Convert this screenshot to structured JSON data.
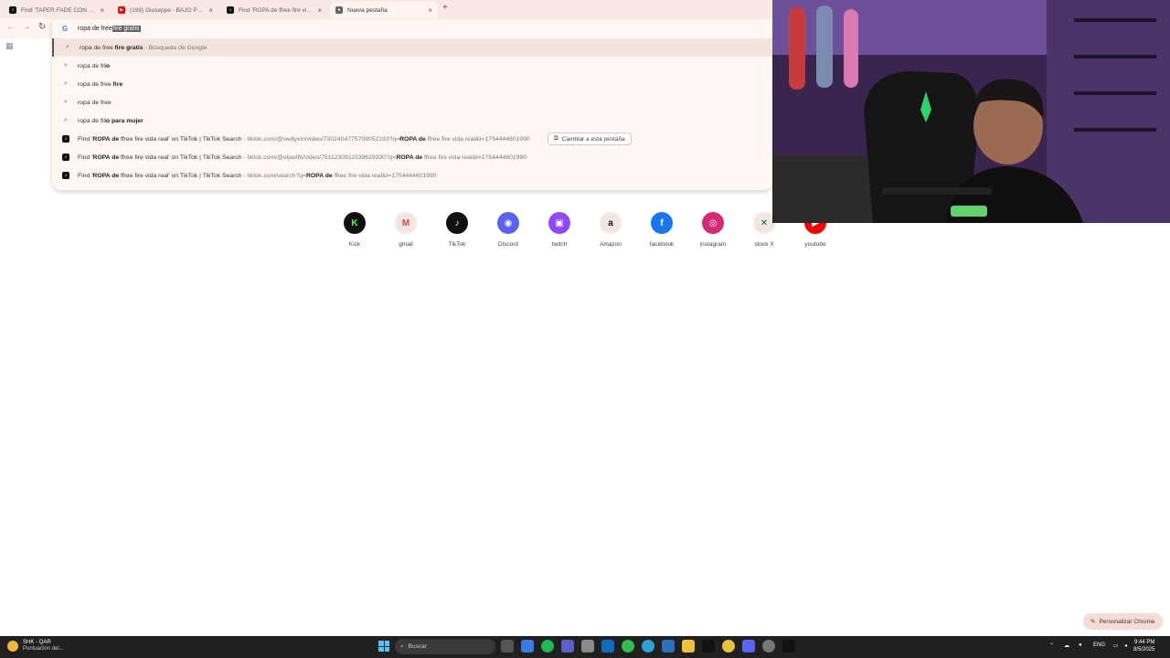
{
  "tabs": [
    {
      "title": "Find 'TAPER FADE CON LINEA'...",
      "fav": "tiktok-icon",
      "color": "#111111"
    },
    {
      "title": "(199) Giuseppe - BAJO PERFIL...",
      "fav": "youtube-icon",
      "color": "#ff0000"
    },
    {
      "title": "Find 'ROPA de ffree fire vida re...",
      "fav": "tiktok-icon",
      "color": "#111111"
    },
    {
      "title": "Nueva pestaña",
      "fav": "chrome-icon",
      "color": "#5f6368"
    }
  ],
  "omnibox": {
    "typed": "ropa de free",
    "autocomplete": "fire gratis",
    "engine_icon": "google-g-icon"
  },
  "suggestions": [
    {
      "prefix": "ropa de free ",
      "bold": "fire gratis",
      "suffix": " - Búsqueda de Google",
      "icon": "search-icon"
    },
    {
      "prefix": "ropa de fr",
      "bold": "io",
      "suffix": "",
      "icon": "search-icon"
    },
    {
      "prefix": "ropa de free ",
      "bold": "fire",
      "suffix": "",
      "icon": "search-icon"
    },
    {
      "prefix": "ropa de free",
      "bold": "",
      "suffix": "",
      "icon": "search-icon"
    },
    {
      "prefix": "ropa de fr",
      "bold": "io para mujer",
      "suffix": "",
      "icon": "search-icon"
    }
  ],
  "tiktok_results": [
    {
      "pre": "Find '",
      "bold": "ROPA de",
      "post": " ffree fire vida real' on TikTok | TikTok Search",
      "url_pre": " - tiktok.com/@wellyxin/video/7302404775709052193?q=",
      "url_bold": "ROPA de",
      "url_post": " ffree fire vida real&t=1754444601990",
      "switch": "Cambiar a esta pestaña"
    },
    {
      "pre": "Find '",
      "bold": "ROPA de",
      "post": " ffree fire vida real' on TikTok | TikTok Search",
      "url_pre": " - tiktok.com/@eljavifb/video/7511230911539629330?q=",
      "url_bold": "ROPA de",
      "url_post": " ffree fire vida real&t=1754444601990",
      "switch": ""
    },
    {
      "pre": "Find '",
      "bold": "ROPA de",
      "post": " ffree fire vida real' on TikTok | TikTok Search",
      "url_pre": " - tiktok.com/search?q=",
      "url_bold": "ROPA de",
      "url_post": " ffree fire vida real&t=1754444601990",
      "switch": ""
    }
  ],
  "shortcuts": [
    {
      "label": "Kick",
      "glyph": "K",
      "color": "#53fc18",
      "bg": "#111111"
    },
    {
      "label": "gmail",
      "glyph": "M",
      "color": "#ea4335",
      "bg": "#f1e6e3"
    },
    {
      "label": "TikTok",
      "glyph": "♪",
      "color": "#ffffff",
      "bg": "#111111"
    },
    {
      "label": "Discord",
      "glyph": "◉",
      "color": "#ffffff",
      "bg": "#5865f2"
    },
    {
      "label": "twitch",
      "glyph": "▣",
      "color": "#ffffff",
      "bg": "#9146ff"
    },
    {
      "label": "Amazon",
      "glyph": "a",
      "color": "#111111",
      "bg": "#f1e6e3"
    },
    {
      "label": "facebook",
      "glyph": "f",
      "color": "#ffffff",
      "bg": "#1877f2"
    },
    {
      "label": "instagram",
      "glyph": "◎",
      "color": "#ffffff",
      "bg": "#d62976"
    },
    {
      "label": "stock X",
      "glyph": "✕",
      "color": "#0a6b3d",
      "bg": "#f1e6e3"
    },
    {
      "label": "youtube",
      "glyph": "▶",
      "color": "#ffffff",
      "bg": "#ff0000"
    }
  ],
  "customize_label": "Personalizar Chrome",
  "taskbar": {
    "weather_title": "SHK - QAR",
    "weather_sub": "Puntuación del...",
    "search_placeholder": "Buscar",
    "lang": "ENG",
    "time": "9:44 PM",
    "date": "8/5/2025"
  }
}
